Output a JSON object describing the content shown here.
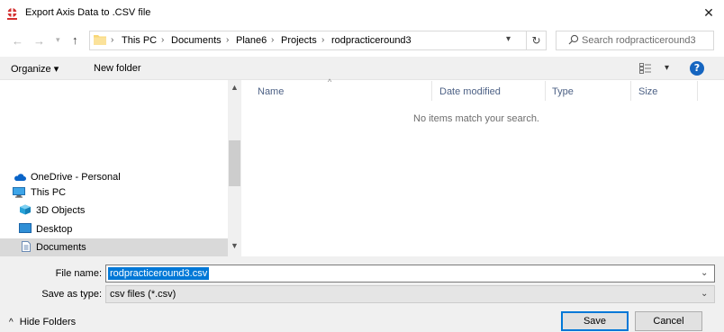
{
  "window": {
    "title": "Export Axis Data to .CSV file",
    "close_label": "✕"
  },
  "address": {
    "breadcrumbs": [
      "This PC",
      "Documents",
      "Plane6",
      "Projects",
      "rodpracticeround3"
    ],
    "search_placeholder": "Search rodpracticeround3"
  },
  "toolbar": {
    "organize_label": "Organize ▾",
    "new_folder_label": "New folder"
  },
  "nav": {
    "items": [
      {
        "label": "OneDrive - Personal",
        "icon": "cloud-icon"
      },
      {
        "label": "This PC",
        "icon": "computer-icon"
      },
      {
        "label": "3D Objects",
        "icon": "3d-objects-icon"
      },
      {
        "label": "Desktop",
        "icon": "desktop-icon"
      },
      {
        "label": "Documents",
        "icon": "documents-icon",
        "selected": true
      }
    ]
  },
  "file_list": {
    "columns": [
      "Name",
      "Date modified",
      "Type",
      "Size"
    ],
    "empty_message": "No items match your search."
  },
  "form": {
    "file_name_label": "File name:",
    "file_name_value": "rodpracticeround3.csv",
    "save_as_type_label": "Save as type:",
    "save_as_type_value": "csv files (*.csv)"
  },
  "footer": {
    "hide_folders_label": "Hide Folders",
    "save_label": "Save",
    "cancel_label": "Cancel"
  },
  "colors": {
    "accent": "#0078d7",
    "help": "#1565c0",
    "app_icon": "#d32f2f",
    "folder": "#f8d775"
  }
}
